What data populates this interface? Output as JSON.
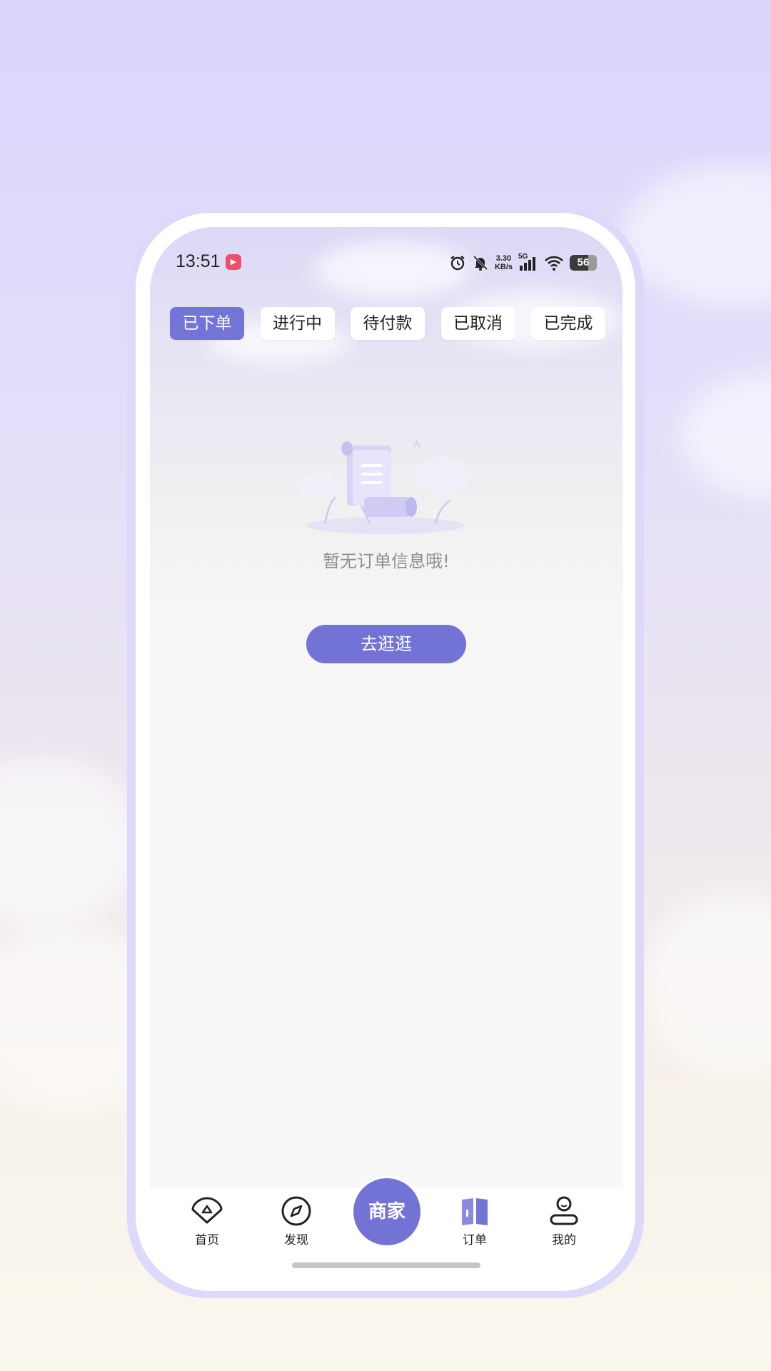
{
  "status_bar": {
    "time": "13:51",
    "app_icon_label": "Kuaiyin",
    "net_speed_value": "3.30",
    "net_speed_unit": "KB/s",
    "network_type": "5G",
    "battery_level": "56"
  },
  "tabs": [
    {
      "label": "已下单",
      "active": true
    },
    {
      "label": "进行中",
      "active": false
    },
    {
      "label": "待付款",
      "active": false
    },
    {
      "label": "已取消",
      "active": false
    },
    {
      "label": "已完成",
      "active": false
    }
  ],
  "empty_state": {
    "illustration_icon": "empty-order-scroll",
    "message": "暂无订单信息哦!",
    "action_label": "去逛逛"
  },
  "tab_bar": {
    "items": [
      {
        "label": "首页",
        "icon": "home-icon"
      },
      {
        "label": "发现",
        "icon": "compass-icon"
      },
      {
        "label": "订单",
        "icon": "order-book-icon",
        "active": true
      },
      {
        "label": "我的",
        "icon": "profile-icon"
      }
    ],
    "center_button_label": "商家"
  },
  "colors": {
    "accent": "#7373d6",
    "background_top": "#dcd8f6",
    "background_bottom": "#f8f8f9"
  }
}
